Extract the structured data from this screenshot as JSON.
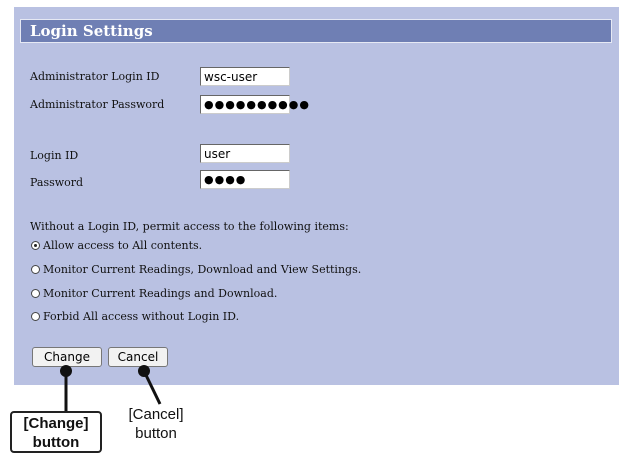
{
  "header": {
    "title": "Login Settings"
  },
  "admin": {
    "login_id_label": "Administrator Login ID",
    "login_id_value": "wsc-user",
    "password_label": "Administrator Password",
    "password_value": "●●●●●●●●●●"
  },
  "user": {
    "login_id_label": "Login ID",
    "login_id_value": "user",
    "password_label": "Password",
    "password_value": "●●●●"
  },
  "access": {
    "prompt": "Without a Login ID, permit access to the following items:",
    "options": [
      {
        "label": "Allow access to All contents.",
        "selected": true
      },
      {
        "label": "Monitor Current Readings, Download and View Settings.",
        "selected": false
      },
      {
        "label": "Monitor Current Readings and Download.",
        "selected": false
      },
      {
        "label": "Forbid All access without Login ID.",
        "selected": false
      }
    ]
  },
  "buttons": {
    "change_label": "Change",
    "cancel_label": "Cancel"
  },
  "callouts": {
    "change_line1": "[Change]",
    "change_line2": "button",
    "cancel_line1": "[Cancel]",
    "cancel_line2": "button"
  }
}
